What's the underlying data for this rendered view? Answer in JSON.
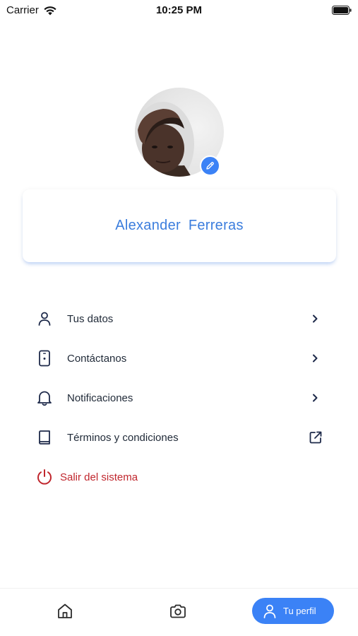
{
  "status_bar": {
    "carrier": "Carrier",
    "time": "10:25 PM"
  },
  "profile": {
    "name": "Alexander  Ferreras"
  },
  "menu": {
    "items": [
      {
        "label": "Tus datos",
        "icon": "user-icon",
        "trailing": "chevron-right-icon"
      },
      {
        "label": "Contáctanos",
        "icon": "phone-icon",
        "trailing": "chevron-right-icon"
      },
      {
        "label": "Notificaciones",
        "icon": "bell-icon",
        "trailing": "chevron-right-icon"
      },
      {
        "label": "Términos y condiciones",
        "icon": "book-icon",
        "trailing": "external-link-icon"
      }
    ],
    "logout_label": "Salir del sistema"
  },
  "bottom_nav": {
    "profile_label": "Tu perfil"
  },
  "colors": {
    "accent": "#3b82f6",
    "name": "#3b7ddd",
    "logout": "#c0262d",
    "icon": "#1e2a4a"
  }
}
